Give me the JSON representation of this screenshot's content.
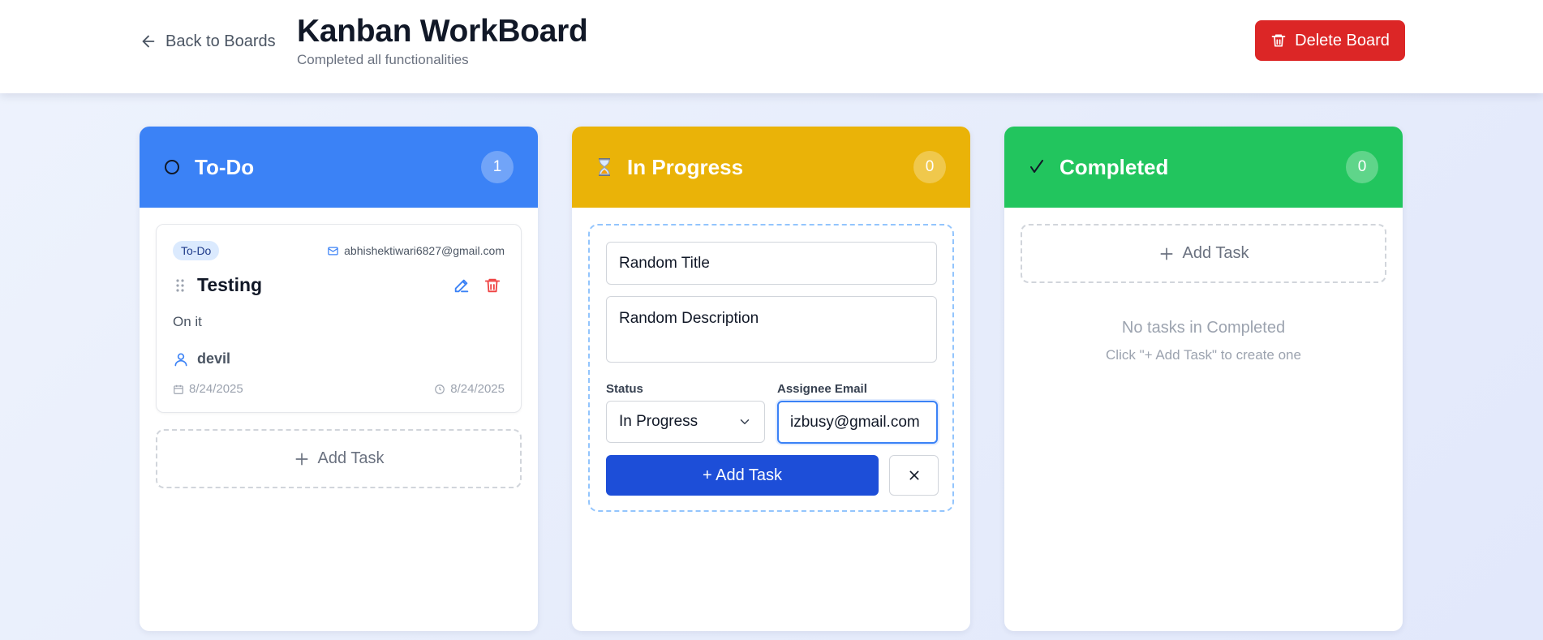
{
  "header": {
    "back_label": "Back to Boards",
    "title": "Kanban WorkBoard",
    "subtitle": "Completed all functionalities",
    "delete_label": "Delete Board"
  },
  "columns": [
    {
      "title": "To-Do",
      "icon": "circle-outline-icon",
      "count": "1",
      "color": "#3b82f6",
      "tasks": [
        {
          "status": "To-Do",
          "email": "abhishektiwari6827@gmail.com",
          "title": "Testing",
          "description": "On it",
          "assignee": "devil",
          "created": "8/24/2025",
          "due": "8/24/2025"
        }
      ],
      "add_label": "Add Task"
    },
    {
      "title": "In Progress",
      "icon": "hourglass-icon",
      "count": "0",
      "color": "#eab308",
      "form": {
        "title_value": "Random Title",
        "description_value": "Random Description",
        "status_label": "Status",
        "status_value": "In Progress",
        "email_label": "Assignee Email",
        "email_value": "izbusy@gmail.com",
        "submit_label": "+ Add Task"
      }
    },
    {
      "title": "Completed",
      "icon": "check-icon",
      "count": "0",
      "color": "#22c55e",
      "add_label": "Add Task",
      "empty_title": "No tasks in Completed",
      "empty_hint": "Click \"+ Add Task\" to create one"
    }
  ],
  "colors": {
    "danger": "#dc2626",
    "primary": "#1d4ed8",
    "focus": "#3b82f6"
  }
}
